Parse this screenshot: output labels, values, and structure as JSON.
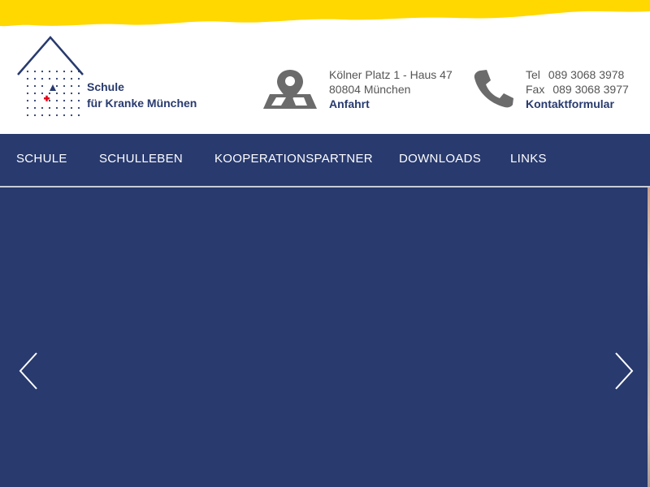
{
  "brand": {
    "line1": "Schule",
    "line2": "für Kranke München",
    "icon": "house-logo-icon"
  },
  "address": {
    "street": "Kölner Platz 1 - Haus 47",
    "city": "80804 München",
    "link": "Anfahrt",
    "icon": "map-pin-icon"
  },
  "contact": {
    "tel_label": "Tel",
    "tel": "089 3068 3978",
    "fax_label": "Fax",
    "fax": "089 3068 3977",
    "link": "Kontaktformular",
    "icon": "phone-icon"
  },
  "nav": {
    "items": [
      {
        "label": "SCHULE"
      },
      {
        "label": "SCHULLEBEN"
      },
      {
        "label": "KOOPERATIONSPARTNER"
      },
      {
        "label": "DOWNLOADS"
      },
      {
        "label": "LINKS"
      }
    ]
  },
  "slider": {
    "prev_icon": "chevron-left-icon",
    "next_icon": "chevron-right-icon"
  },
  "colors": {
    "accent_yellow": "#ffd800",
    "brand_blue": "#283a6e",
    "icon_grey": "#666666",
    "cross_red": "#e2001a"
  }
}
